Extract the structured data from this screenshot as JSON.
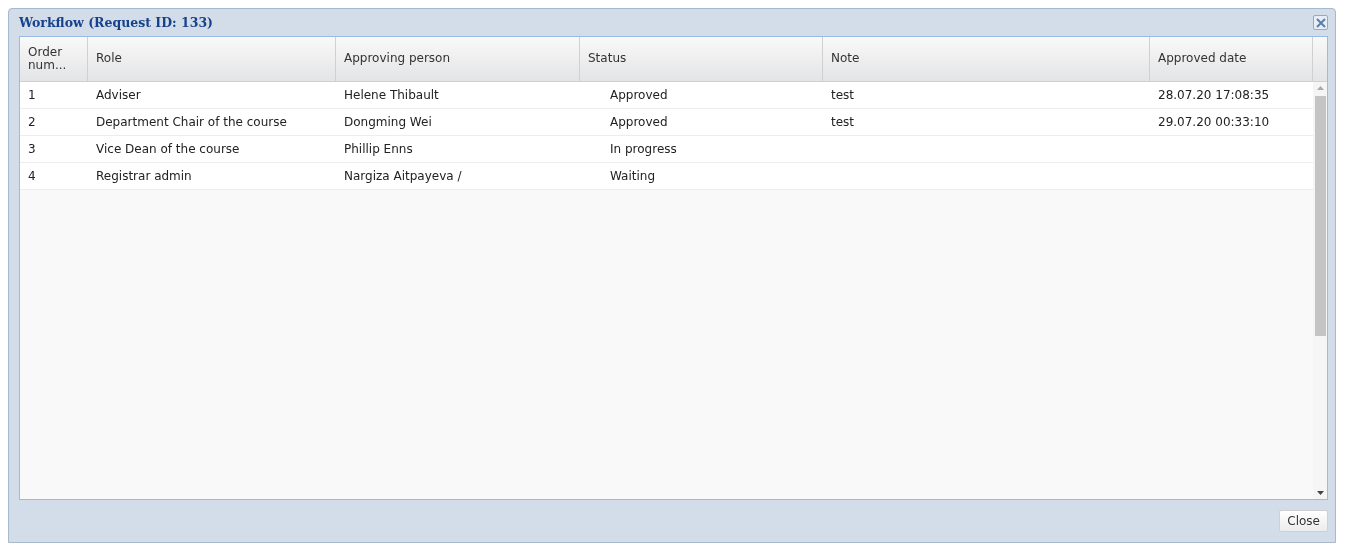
{
  "window": {
    "title": "Workflow (Request ID: 133)"
  },
  "table": {
    "columns": [
      "Order num...",
      "Role",
      "Approving person",
      "Status",
      "Note",
      "Approved date"
    ],
    "rows": [
      {
        "order": "1",
        "role": "Adviser",
        "person": "Helene Thibault",
        "status": "Approved",
        "note": "test",
        "date": "28.07.20 17:08:35"
      },
      {
        "order": "2",
        "role": "Department Chair of the course",
        "person": "Dongming Wei",
        "status": "Approved",
        "note": "test",
        "date": "29.07.20 00:33:10"
      },
      {
        "order": "3",
        "role": "Vice Dean of the course",
        "person": "Phillip Enns",
        "status": "In progress"
      },
      {
        "order": "4",
        "role": "Registrar admin",
        "person": "Nargiza Aitpayeva /",
        "status": "Waiting"
      }
    ]
  },
  "buttons": [
    "Close"
  ]
}
